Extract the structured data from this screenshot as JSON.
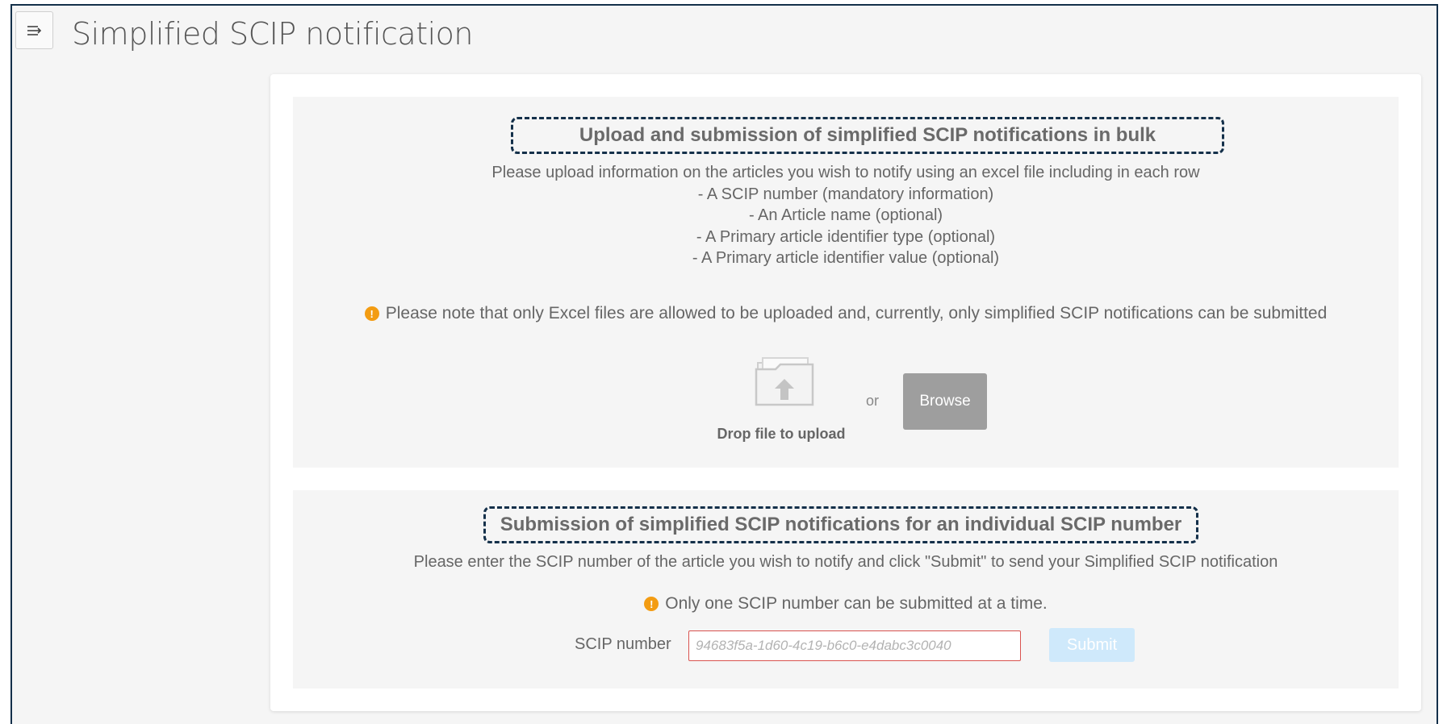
{
  "header": {
    "menu_icon": "menu-collapse-icon",
    "title": "Simplified SCIP notification"
  },
  "bulk_section": {
    "heading": "Upload and submission of simplified SCIP notifications in bulk",
    "description_lines": [
      "Please upload information on the articles you wish to notify using an excel file including in each row",
      "- A SCIP number (mandatory information)",
      "- An Article name (optional)",
      "- A Primary article identifier type (optional)",
      "- A Primary article identifier value (optional)"
    ],
    "note": "Please note that only Excel files are allowed to be uploaded and, currently, only simplified SCIP notifications can be submitted",
    "note_icon": "warning-icon",
    "upload_icon": "folder-upload-icon",
    "drop_label": "Drop file to upload",
    "or_text": "or",
    "browse_label": "Browse"
  },
  "individual_section": {
    "heading": "Submission of simplified SCIP notifications for an individual SCIP number",
    "description": "Please enter the SCIP number of the article you wish to notify and click \"Submit\" to send your Simplified SCIP notification",
    "note": "Only one SCIP number can be submitted at a time.",
    "note_icon": "warning-icon",
    "scip_label": "SCIP number",
    "scip_placeholder": "94683f5a-1d60-4c19-b6c0-e4dabc3c0040",
    "scip_value": "",
    "submit_label": "Submit"
  },
  "colors": {
    "frame_border": "#14304a",
    "warning": "#f39c12",
    "browse_button": "#9e9e9e",
    "submit_button_disabled": "#cfe9fb",
    "input_error_border": "#d9534f"
  }
}
